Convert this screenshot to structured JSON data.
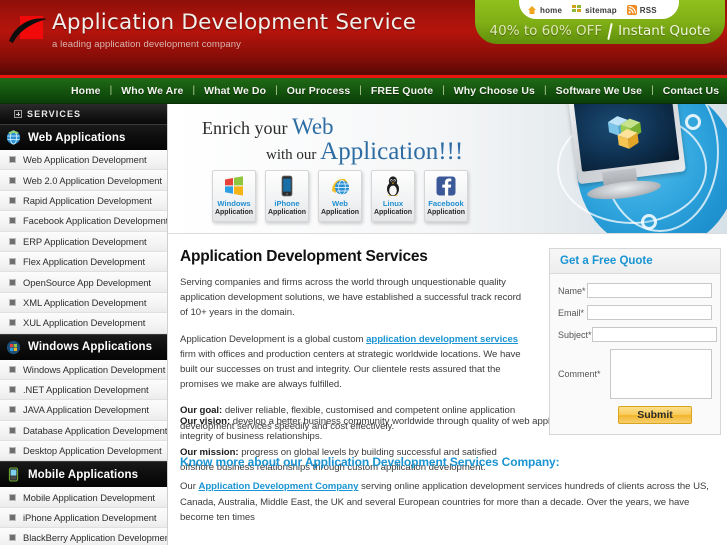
{
  "header": {
    "title": "Application Development Service",
    "tagline": "a leading application development company",
    "logo_icon": "red-square-swoosh-logo",
    "promo": {
      "links": [
        {
          "label": "home",
          "icon": "home-icon"
        },
        {
          "label": "sitemap",
          "icon": "sitemap-icon"
        },
        {
          "label": "RSS",
          "icon": "rss-icon"
        }
      ],
      "offer": "40% to 60% OFF",
      "quote": "Instant Quote"
    }
  },
  "nav": {
    "separator": "|",
    "items": [
      "Home",
      "Who We Are",
      "What We Do",
      "Our Process",
      "FREE Quote",
      "Why Choose Us",
      "Software We Use",
      "Contact Us"
    ]
  },
  "sidebar": {
    "services_label": "SERVICES",
    "expand_icon": "plus-box-icon",
    "groups": [
      {
        "label": "Web Applications",
        "icon": "globe-icon",
        "items": [
          "Web Application Development",
          "Web 2.0 Application Development",
          "Rapid Application Development",
          "Facebook Application Development",
          "ERP Application Development",
          "Flex Application Development",
          "OpenSource App Development",
          "XML Application Development",
          "XUL Application Development"
        ]
      },
      {
        "label": "Windows Applications",
        "icon": "windows-orb-icon",
        "items": [
          "Windows Application Development",
          ".NET Application Development",
          "JAVA Application Development",
          "Database Application Development",
          "Desktop Application Development"
        ]
      },
      {
        "label": "Mobile Applications",
        "icon": "mobile-phone-icon",
        "items": [
          "Mobile Application Development",
          "iPhone Application Development",
          "BlackBerry Application Development"
        ]
      }
    ]
  },
  "banner": {
    "line1_a": "Enrich your ",
    "line1_b": "Web",
    "line2_a": "with our ",
    "line2_b": "Application!!!",
    "tiles": [
      {
        "top": "Windows",
        "bottom": "Application",
        "icon": "windows-logo-icon"
      },
      {
        "top": "iPhone",
        "bottom": "Application",
        "icon": "iphone-icon"
      },
      {
        "top": "Web",
        "bottom": "Application",
        "icon": "web-globe-icon"
      },
      {
        "top": "Linux",
        "bottom": "Application",
        "icon": "linux-penguin-icon"
      },
      {
        "top": "Facebook",
        "bottom": "Application",
        "icon": "facebook-icon"
      }
    ],
    "monitor_icon": "monitor-with-cubes-icon",
    "globe_icon": "blue-network-globe-icon"
  },
  "article": {
    "heading": "Application Development Services",
    "p1": "Serving companies and firms across the world through unquestionable quality application development solutions, we have established a successful track record of 10+ years in the domain.",
    "p2_before": "Application Development is a global custom ",
    "p2_link": "application development services",
    "p2_after": " firm with offices and production centers at strategic worldwide locations. We have built our successes on trust and integrity. Our clientele rests assured that the promises we make are always fulfilled.",
    "goal_label": "Our goal:",
    "goal_text": " deliver reliable, flexible, customised and competent online application development services speedily and cost effectively.",
    "mission_label": "Our mission:",
    "mission_text": " progress on global levels by building successful and satisfied offshore business relationships through custom application development.",
    "vision_label": "Our vision:",
    "vision_text": " develop a better business community worldwide through quality of web application development solutions and integrity of business relationships.",
    "subheading": "Know more about our Application Development Services Company:",
    "p3_before": "Our ",
    "p3_link": "Application Development Company",
    "p3_after": " serving online application development services hundreds of clients across the US, Canada, Australia, Middle East, the UK and several European countries for more than a decade. Over the years, we have become ten times"
  },
  "quote_form": {
    "title": "Get a Free Quote",
    "fields": [
      {
        "label": "Name*",
        "value": "",
        "placeholder": ""
      },
      {
        "label": "Email*",
        "value": "",
        "placeholder": ""
      },
      {
        "label": "Subject*",
        "value": "",
        "placeholder": ""
      }
    ],
    "comment_label": "Comment*",
    "comment_value": "",
    "submit_label": "Submit"
  },
  "colors": {
    "header_red": "#a4120b",
    "nav_green": "#175910",
    "promo_green": "#7fae16",
    "link_blue": "#1a94d2",
    "submit_yellow": "#f9cb5a"
  }
}
